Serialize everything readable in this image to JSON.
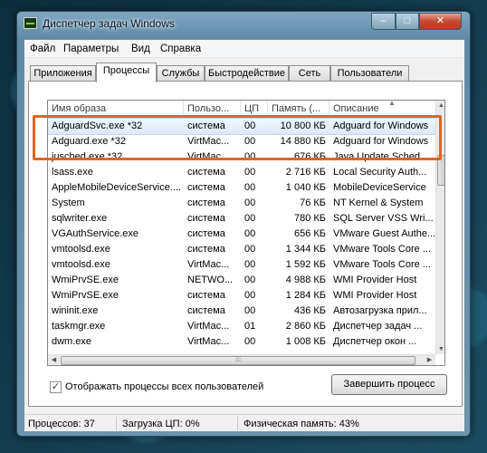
{
  "window": {
    "title": "Диспетчер задач Windows",
    "min_glyph": "‒",
    "max_glyph": "□",
    "close_glyph": "✕"
  },
  "menu": [
    "Файл",
    "Параметры",
    "Вид",
    "Справка"
  ],
  "tabs": [
    {
      "label": "Приложения",
      "active": false
    },
    {
      "label": "Процессы",
      "active": true
    },
    {
      "label": "Службы",
      "active": false
    },
    {
      "label": "Быстродействие",
      "active": false
    },
    {
      "label": "Сеть",
      "active": false
    },
    {
      "label": "Пользователи",
      "active": false
    }
  ],
  "columns": [
    "Имя образа",
    "Пользо...",
    "ЦП",
    "Память (...",
    "Описание"
  ],
  "sort_glyph": "▲",
  "processes": [
    {
      "name": "AdguardSvc.exe *32",
      "user": "система",
      "cpu": "00",
      "mem": "10 800 КБ",
      "desc": "Adguard for Windows",
      "selected": true
    },
    {
      "name": "Adguard.exe *32",
      "user": "VirtMac...",
      "cpu": "00",
      "mem": "14 880 КБ",
      "desc": "Adguard for Windows",
      "selected": false
    },
    {
      "name": "jusched.exe *32",
      "user": "VirtMac...",
      "cpu": "00",
      "mem": "676 КБ",
      "desc": "Java Update Sched...",
      "selected": false
    },
    {
      "name": "lsass.exe",
      "user": "система",
      "cpu": "00",
      "mem": "2 716 КБ",
      "desc": "Local Security Auth...",
      "selected": false
    },
    {
      "name": "AppleMobileDeviceService....",
      "user": "система",
      "cpu": "00",
      "mem": "1 040 КБ",
      "desc": "MobileDeviceService",
      "selected": false
    },
    {
      "name": "System",
      "user": "система",
      "cpu": "00",
      "mem": "76 КБ",
      "desc": "NT Kernel & System",
      "selected": false
    },
    {
      "name": "sqlwriter.exe",
      "user": "система",
      "cpu": "00",
      "mem": "780 КБ",
      "desc": "SQL Server VSS Wri...",
      "selected": false
    },
    {
      "name": "VGAuthService.exe",
      "user": "система",
      "cpu": "00",
      "mem": "656 КБ",
      "desc": "VMware Guest Authe...",
      "selected": false
    },
    {
      "name": "vmtoolsd.exe",
      "user": "система",
      "cpu": "00",
      "mem": "1 344 КБ",
      "desc": "VMware Tools Core ...",
      "selected": false
    },
    {
      "name": "vmtoolsd.exe",
      "user": "VirtMac...",
      "cpu": "00",
      "mem": "1 592 КБ",
      "desc": "VMware Tools Core ...",
      "selected": false
    },
    {
      "name": "WmiPrvSE.exe",
      "user": "NETWO...",
      "cpu": "00",
      "mem": "4 988 КБ",
      "desc": "WMI Provider Host",
      "selected": false
    },
    {
      "name": "WmiPrvSE.exe",
      "user": "система",
      "cpu": "00",
      "mem": "1 284 КБ",
      "desc": "WMI Provider Host",
      "selected": false
    },
    {
      "name": "wininit.exe",
      "user": "система",
      "cpu": "00",
      "mem": "436 КБ",
      "desc": "Автозагрузка прил...",
      "selected": false
    },
    {
      "name": "taskmgr.exe",
      "user": "VirtMac...",
      "cpu": "01",
      "mem": "2 860 КБ",
      "desc": "Диспетчер задач ...",
      "selected": false
    },
    {
      "name": "dwm.exe",
      "user": "VirtMac...",
      "cpu": "00",
      "mem": "1 008 КБ",
      "desc": "Диспетчер окон ...",
      "selected": false
    }
  ],
  "show_all_users": {
    "checked": true,
    "check_glyph": "✓",
    "label": "Отображать процессы всех пользователей"
  },
  "end_process_label": "Завершить процесс",
  "status": {
    "processes": "Процессов: 37",
    "cpu": "Загрузка ЦП: 0%",
    "memory": "Физическая память: 43%"
  }
}
